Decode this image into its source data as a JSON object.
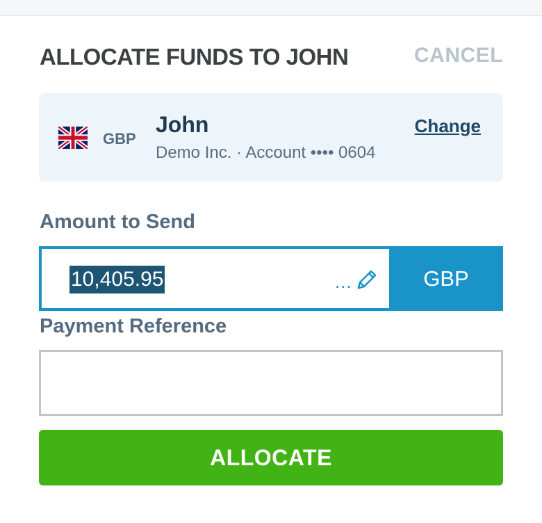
{
  "header": {
    "title": "ALLOCATE FUNDS TO JOHN",
    "cancel_label": "CANCEL"
  },
  "recipient": {
    "flag_icon": "uk-flag-icon",
    "currency": "GBP",
    "name": "John",
    "meta": "Demo Inc. · Account •••• 0604",
    "change_label": "Change"
  },
  "amount": {
    "label": "Amount to Send",
    "value": "10,405.95",
    "ellipsis": "...",
    "edit_icon": "pencil-icon",
    "currency": "GBP"
  },
  "reference": {
    "label": "Payment Reference",
    "value": "",
    "placeholder": ""
  },
  "actions": {
    "allocate_label": "ALLOCATE"
  },
  "colors": {
    "accent_blue": "#1a93c9",
    "selection_bg": "#1d5574",
    "allocate_green": "#42b314",
    "card_bg": "#edf4fa",
    "cancel_grey": "#b9c3cc"
  }
}
